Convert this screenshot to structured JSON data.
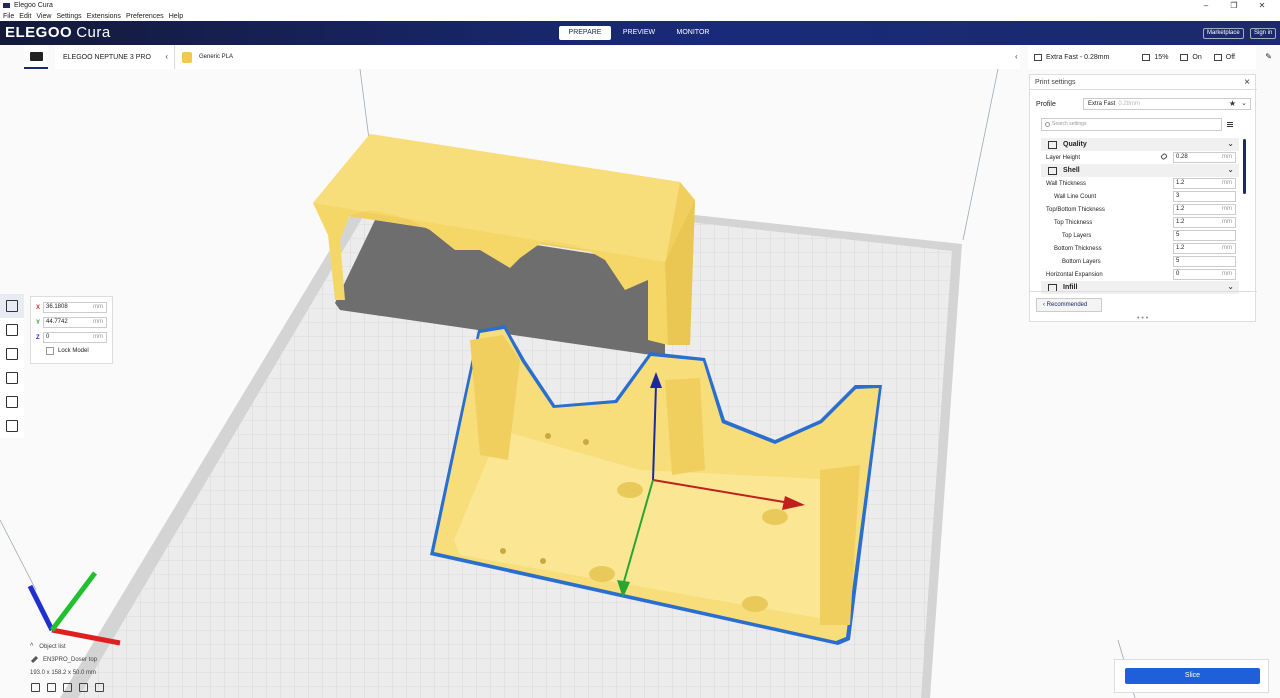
{
  "window": {
    "title": "Elegoo Cura",
    "controls": [
      "–",
      "❐",
      "✕"
    ]
  },
  "menu": [
    "File",
    "Edit",
    "View",
    "Settings",
    "Extensions",
    "Preferences",
    "Help"
  ],
  "header": {
    "logo_main": "ELEGOO",
    "logo_sub": "Cura",
    "stages": [
      "PREPARE",
      "PREVIEW",
      "MONITOR"
    ],
    "active_stage": "PREPARE",
    "marketplace": "Marketplace",
    "sign_in": "Sign in"
  },
  "toolbar": {
    "machine": "ELEGOO NEPTUNE 3 PRO",
    "material": "Generic PLA",
    "profile_summary": "Extra Fast - 0.28mm",
    "infill": "15%",
    "support": "On",
    "adhesion": "Off"
  },
  "move_tool": {
    "x_label": "X",
    "x_value": "36.1808",
    "y_label": "Y",
    "y_value": "44.7742",
    "z_label": "Z",
    "z_value": "0",
    "unit": "mm",
    "lock_label": "Lock Model"
  },
  "print_settings": {
    "title": "Print settings",
    "profile_label": "Profile",
    "profile_value": "Extra Fast",
    "profile_sub": "0.28mm",
    "search_placeholder": "Search settings",
    "categories": {
      "quality": "Quality",
      "shell": "Shell",
      "infill": "Infill"
    },
    "rows": {
      "layer_height": {
        "label": "Layer Height",
        "value": "0.28",
        "unit": "mm"
      },
      "wall_thickness": {
        "label": "Wall Thickness",
        "value": "1.2",
        "unit": "mm"
      },
      "wall_line_count": {
        "label": "Wall Line Count",
        "value": "3"
      },
      "top_bottom_thickness": {
        "label": "Top/Bottom Thickness",
        "value": "1.2",
        "unit": "mm"
      },
      "top_thickness": {
        "label": "Top Thickness",
        "value": "1.2",
        "unit": "mm"
      },
      "top_layers": {
        "label": "Top Layers",
        "value": "5"
      },
      "bottom_thickness": {
        "label": "Bottom Thickness",
        "value": "1.2",
        "unit": "mm"
      },
      "bottom_layers": {
        "label": "Bottom Layers",
        "value": "5"
      },
      "horizontal_expansion": {
        "label": "Horizontal Expansion",
        "value": "0",
        "unit": "mm"
      }
    },
    "recommended_label": "Recommended"
  },
  "object_list": {
    "label": "Object list",
    "object_name": "EN3PRO_Doser top",
    "dimensions": "193.0 x 158.2 x 50.0 mm"
  },
  "slice": {
    "label": "Slice"
  },
  "colors": {
    "header_dark": "#141a3a",
    "header_blue": "#192a7a",
    "model_yellow": "#f7de7a",
    "selection_blue": "#2a6ed0",
    "slice_button": "#1f5fd9"
  }
}
